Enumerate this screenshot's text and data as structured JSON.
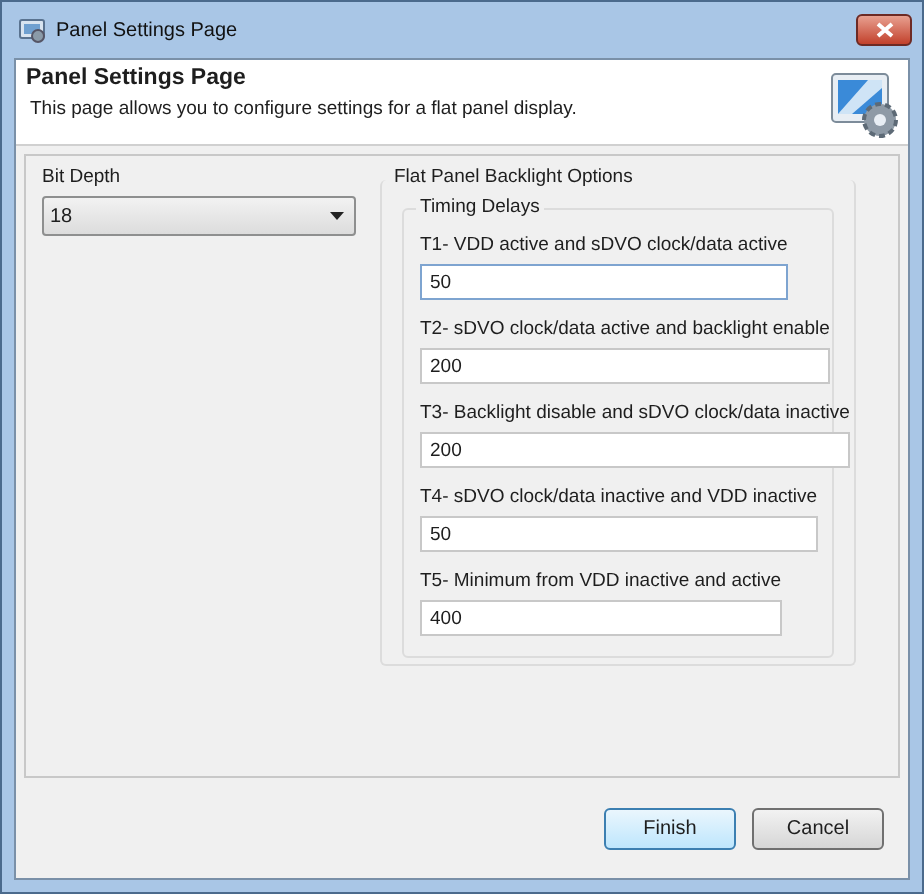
{
  "window": {
    "title": "Panel Settings Page"
  },
  "header": {
    "title": "Panel Settings Page",
    "description": "This page allows you to configure settings for a flat panel display."
  },
  "bit_depth": {
    "label": "Bit Depth",
    "value": "18"
  },
  "backlight": {
    "title": "Flat Panel Backlight Options",
    "timing": {
      "title": "Timing Delays",
      "fields": [
        {
          "label": "T1- VDD active and sDVO clock/data active",
          "value": "50",
          "focused": true
        },
        {
          "label": "T2- sDVO clock/data active and backlight enable",
          "value": "200",
          "focused": false
        },
        {
          "label": "T3- Backlight disable and sDVO clock/data inactive",
          "value": "200",
          "focused": false
        },
        {
          "label": "T4- sDVO clock/data inactive and VDD inactive",
          "value": "50",
          "focused": false
        },
        {
          "label": "T5- Minimum from VDD inactive and active",
          "value": "400",
          "focused": false
        }
      ]
    }
  },
  "buttons": [
    {
      "label": "Finish",
      "kind": "default"
    },
    {
      "label": "Cancel",
      "kind": "normal"
    }
  ]
}
